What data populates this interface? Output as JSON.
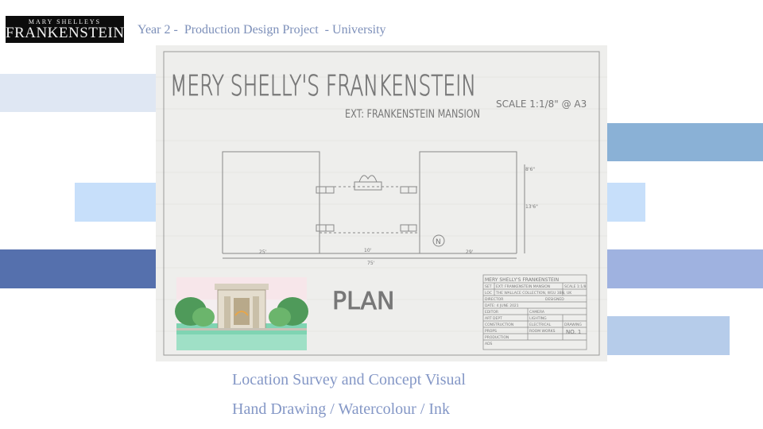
{
  "logo": {
    "line1": "MARY SHELLEYS",
    "line2": "FRANKENSTEIN"
  },
  "header": {
    "text": "Year 2 -  Production Design Project  - University"
  },
  "drawing": {
    "title": "MERY SHELLY'S  FRANKENSTEIN",
    "subtitle": "EXT: FRANKENSTEIN MANSION",
    "scale": "SCALE 1:1/8\" @ A3",
    "plan_label": "PLAN",
    "north": "N",
    "dims": [
      "8'6\"",
      "13'6\"",
      "25'",
      "10'",
      "29'",
      "75'"
    ],
    "title_block": {
      "title": "MERY SHELLY'S FRANKENSTEIN",
      "rows": [
        [
          "SET",
          "EXT: FRANKENSTEIN MANSION",
          "SCALE 1:1/8"
        ],
        [
          "LOC",
          "THE WALLACE COLLECTION, W1U 3BN, UK",
          ""
        ],
        [
          "DIRECTOR",
          "",
          "DESIGNED"
        ],
        [
          "DATE: 4 JUNE 2021",
          "",
          ""
        ],
        [
          "EDITOR",
          "CAMERA",
          ""
        ],
        [
          "ART DEPT",
          "LIGHTING",
          ""
        ],
        [
          "CONSTRUCTION",
          "ELECTRICAL",
          "DRAWING"
        ],
        [
          "PROPS",
          "ROOM WORKS",
          "NO. 1"
        ],
        [
          "PRODUCTION",
          "",
          ""
        ],
        [
          "ADS",
          "",
          ""
        ]
      ]
    }
  },
  "captions": {
    "line1": "Location Survey and Concept Visual",
    "line2": "Hand Drawing / Watercolour / Ink"
  },
  "colors": {
    "band_pale": "#dfe7f3",
    "band_sky": "#c7dffa",
    "band_royal": "#5570ad",
    "band_steel": "#8ab1d6",
    "band_periwinkle": "#9fb2e0",
    "band_light": "#b6ccea",
    "caption": "#8497c6",
    "header": "#7c8fb9"
  }
}
